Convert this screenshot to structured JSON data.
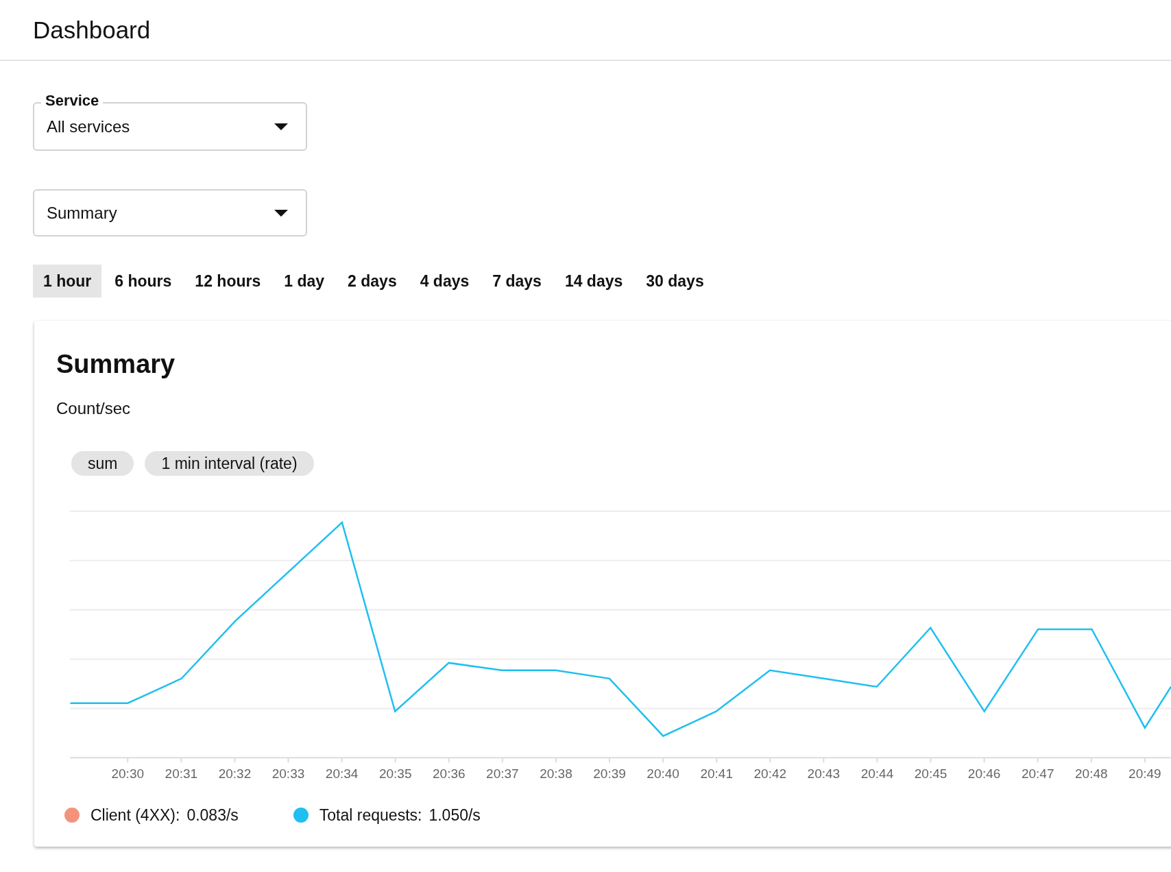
{
  "header": {
    "title": "Dashboard"
  },
  "service_select": {
    "label": "Service",
    "value": "All services"
  },
  "view_select": {
    "value": "Summary"
  },
  "time_ranges": [
    {
      "label": "1 hour",
      "selected": true
    },
    {
      "label": "6 hours",
      "selected": false
    },
    {
      "label": "12 hours",
      "selected": false
    },
    {
      "label": "1 day",
      "selected": false
    },
    {
      "label": "2 days",
      "selected": false
    },
    {
      "label": "4 days",
      "selected": false
    },
    {
      "label": "7 days",
      "selected": false
    },
    {
      "label": "14 days",
      "selected": false
    },
    {
      "label": "30 days",
      "selected": false
    }
  ],
  "card": {
    "title": "Summary",
    "unit": "Count/sec",
    "chips": [
      "sum",
      "1 min interval (rate)"
    ],
    "x_ticks": [
      "20:30",
      "20:31",
      "20:32",
      "20:33",
      "20:34",
      "20:35",
      "20:36",
      "20:37",
      "20:38",
      "20:39",
      "20:40",
      "20:41",
      "20:42",
      "20:43",
      "20:44",
      "20:45",
      "20:46",
      "20:47",
      "20:48",
      "20:49"
    ],
    "legend": [
      {
        "label": "Client (4XX):",
        "value": "0.083/s",
        "color": "#f4937c"
      },
      {
        "label": "Total requests:",
        "value": "1.050/s",
        "color": "#1fbff0"
      }
    ]
  }
}
